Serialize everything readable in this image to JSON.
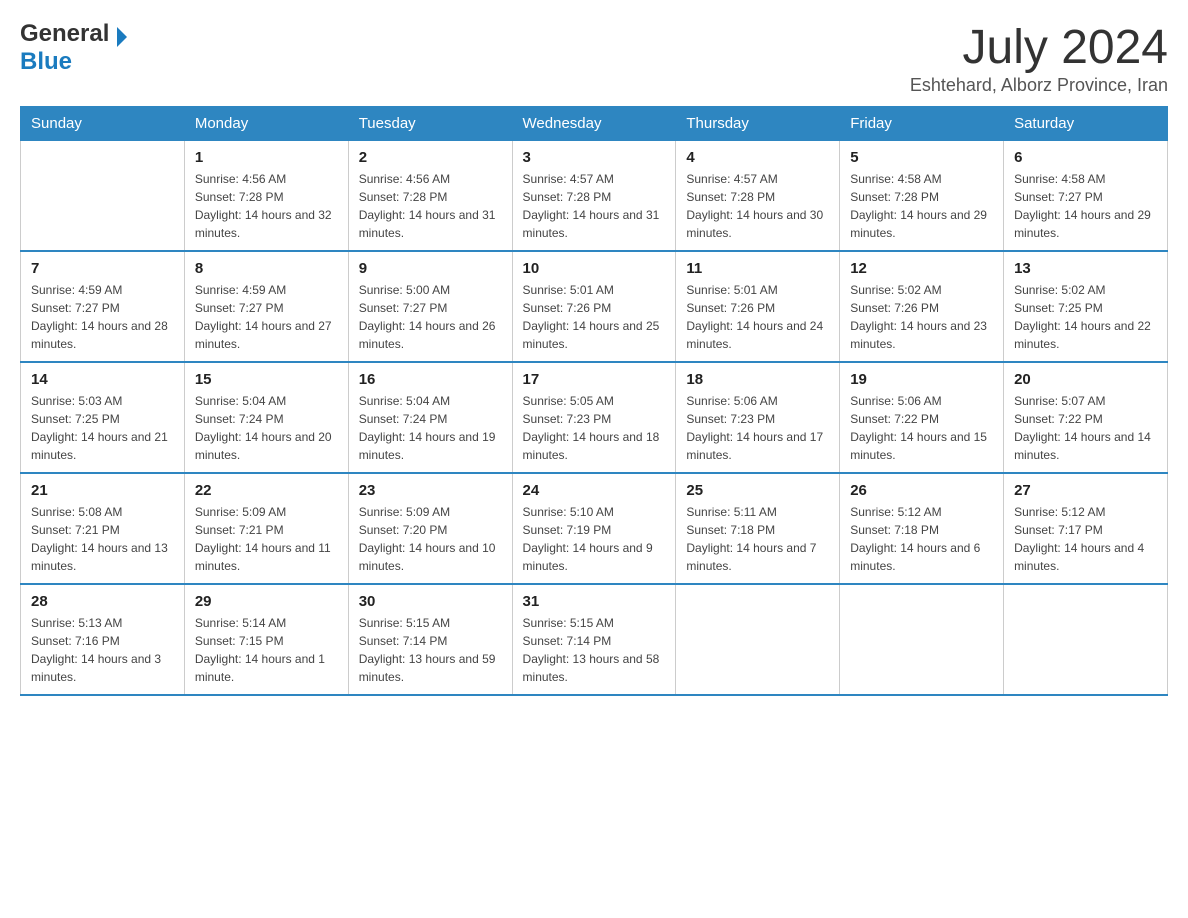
{
  "header": {
    "logo": {
      "text_general": "General",
      "text_blue": "Blue"
    },
    "title": "July 2024",
    "subtitle": "Eshtehard, Alborz Province, Iran"
  },
  "calendar": {
    "days_of_week": [
      "Sunday",
      "Monday",
      "Tuesday",
      "Wednesday",
      "Thursday",
      "Friday",
      "Saturday"
    ],
    "weeks": [
      [
        {
          "day": "",
          "sunrise": "",
          "sunset": "",
          "daylight": ""
        },
        {
          "day": "1",
          "sunrise": "Sunrise: 4:56 AM",
          "sunset": "Sunset: 7:28 PM",
          "daylight": "Daylight: 14 hours and 32 minutes."
        },
        {
          "day": "2",
          "sunrise": "Sunrise: 4:56 AM",
          "sunset": "Sunset: 7:28 PM",
          "daylight": "Daylight: 14 hours and 31 minutes."
        },
        {
          "day": "3",
          "sunrise": "Sunrise: 4:57 AM",
          "sunset": "Sunset: 7:28 PM",
          "daylight": "Daylight: 14 hours and 31 minutes."
        },
        {
          "day": "4",
          "sunrise": "Sunrise: 4:57 AM",
          "sunset": "Sunset: 7:28 PM",
          "daylight": "Daylight: 14 hours and 30 minutes."
        },
        {
          "day": "5",
          "sunrise": "Sunrise: 4:58 AM",
          "sunset": "Sunset: 7:28 PM",
          "daylight": "Daylight: 14 hours and 29 minutes."
        },
        {
          "day": "6",
          "sunrise": "Sunrise: 4:58 AM",
          "sunset": "Sunset: 7:27 PM",
          "daylight": "Daylight: 14 hours and 29 minutes."
        }
      ],
      [
        {
          "day": "7",
          "sunrise": "Sunrise: 4:59 AM",
          "sunset": "Sunset: 7:27 PM",
          "daylight": "Daylight: 14 hours and 28 minutes."
        },
        {
          "day": "8",
          "sunrise": "Sunrise: 4:59 AM",
          "sunset": "Sunset: 7:27 PM",
          "daylight": "Daylight: 14 hours and 27 minutes."
        },
        {
          "day": "9",
          "sunrise": "Sunrise: 5:00 AM",
          "sunset": "Sunset: 7:27 PM",
          "daylight": "Daylight: 14 hours and 26 minutes."
        },
        {
          "day": "10",
          "sunrise": "Sunrise: 5:01 AM",
          "sunset": "Sunset: 7:26 PM",
          "daylight": "Daylight: 14 hours and 25 minutes."
        },
        {
          "day": "11",
          "sunrise": "Sunrise: 5:01 AM",
          "sunset": "Sunset: 7:26 PM",
          "daylight": "Daylight: 14 hours and 24 minutes."
        },
        {
          "day": "12",
          "sunrise": "Sunrise: 5:02 AM",
          "sunset": "Sunset: 7:26 PM",
          "daylight": "Daylight: 14 hours and 23 minutes."
        },
        {
          "day": "13",
          "sunrise": "Sunrise: 5:02 AM",
          "sunset": "Sunset: 7:25 PM",
          "daylight": "Daylight: 14 hours and 22 minutes."
        }
      ],
      [
        {
          "day": "14",
          "sunrise": "Sunrise: 5:03 AM",
          "sunset": "Sunset: 7:25 PM",
          "daylight": "Daylight: 14 hours and 21 minutes."
        },
        {
          "day": "15",
          "sunrise": "Sunrise: 5:04 AM",
          "sunset": "Sunset: 7:24 PM",
          "daylight": "Daylight: 14 hours and 20 minutes."
        },
        {
          "day": "16",
          "sunrise": "Sunrise: 5:04 AM",
          "sunset": "Sunset: 7:24 PM",
          "daylight": "Daylight: 14 hours and 19 minutes."
        },
        {
          "day": "17",
          "sunrise": "Sunrise: 5:05 AM",
          "sunset": "Sunset: 7:23 PM",
          "daylight": "Daylight: 14 hours and 18 minutes."
        },
        {
          "day": "18",
          "sunrise": "Sunrise: 5:06 AM",
          "sunset": "Sunset: 7:23 PM",
          "daylight": "Daylight: 14 hours and 17 minutes."
        },
        {
          "day": "19",
          "sunrise": "Sunrise: 5:06 AM",
          "sunset": "Sunset: 7:22 PM",
          "daylight": "Daylight: 14 hours and 15 minutes."
        },
        {
          "day": "20",
          "sunrise": "Sunrise: 5:07 AM",
          "sunset": "Sunset: 7:22 PM",
          "daylight": "Daylight: 14 hours and 14 minutes."
        }
      ],
      [
        {
          "day": "21",
          "sunrise": "Sunrise: 5:08 AM",
          "sunset": "Sunset: 7:21 PM",
          "daylight": "Daylight: 14 hours and 13 minutes."
        },
        {
          "day": "22",
          "sunrise": "Sunrise: 5:09 AM",
          "sunset": "Sunset: 7:21 PM",
          "daylight": "Daylight: 14 hours and 11 minutes."
        },
        {
          "day": "23",
          "sunrise": "Sunrise: 5:09 AM",
          "sunset": "Sunset: 7:20 PM",
          "daylight": "Daylight: 14 hours and 10 minutes."
        },
        {
          "day": "24",
          "sunrise": "Sunrise: 5:10 AM",
          "sunset": "Sunset: 7:19 PM",
          "daylight": "Daylight: 14 hours and 9 minutes."
        },
        {
          "day": "25",
          "sunrise": "Sunrise: 5:11 AM",
          "sunset": "Sunset: 7:18 PM",
          "daylight": "Daylight: 14 hours and 7 minutes."
        },
        {
          "day": "26",
          "sunrise": "Sunrise: 5:12 AM",
          "sunset": "Sunset: 7:18 PM",
          "daylight": "Daylight: 14 hours and 6 minutes."
        },
        {
          "day": "27",
          "sunrise": "Sunrise: 5:12 AM",
          "sunset": "Sunset: 7:17 PM",
          "daylight": "Daylight: 14 hours and 4 minutes."
        }
      ],
      [
        {
          "day": "28",
          "sunrise": "Sunrise: 5:13 AM",
          "sunset": "Sunset: 7:16 PM",
          "daylight": "Daylight: 14 hours and 3 minutes."
        },
        {
          "day": "29",
          "sunrise": "Sunrise: 5:14 AM",
          "sunset": "Sunset: 7:15 PM",
          "daylight": "Daylight: 14 hours and 1 minute."
        },
        {
          "day": "30",
          "sunrise": "Sunrise: 5:15 AM",
          "sunset": "Sunset: 7:14 PM",
          "daylight": "Daylight: 13 hours and 59 minutes."
        },
        {
          "day": "31",
          "sunrise": "Sunrise: 5:15 AM",
          "sunset": "Sunset: 7:14 PM",
          "daylight": "Daylight: 13 hours and 58 minutes."
        },
        {
          "day": "",
          "sunrise": "",
          "sunset": "",
          "daylight": ""
        },
        {
          "day": "",
          "sunrise": "",
          "sunset": "",
          "daylight": ""
        },
        {
          "day": "",
          "sunrise": "",
          "sunset": "",
          "daylight": ""
        }
      ]
    ]
  }
}
